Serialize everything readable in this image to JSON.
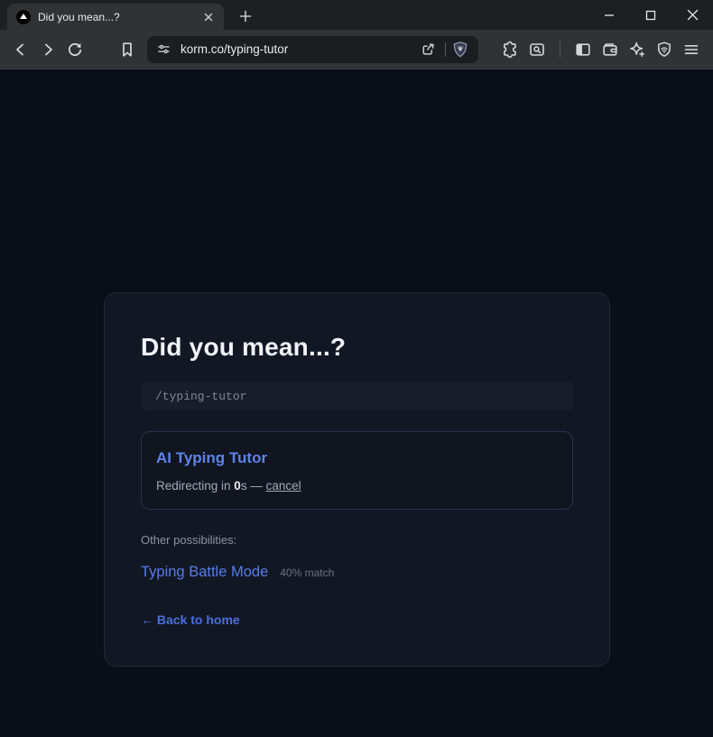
{
  "window": {
    "tab": {
      "title": "Did you mean...?"
    }
  },
  "toolbar": {
    "url": "korm.co/typing-tutor"
  },
  "page": {
    "title": "Did you mean...?",
    "path_input": "/typing-tutor",
    "suggestion": {
      "title": "AI Typing Tutor",
      "redirect_prefix": "Redirecting in ",
      "redirect_seconds": "0",
      "redirect_suffix": "s — ",
      "cancel_label": "cancel"
    },
    "other_heading": "Other possibilities:",
    "alternatives": [
      {
        "label": "Typing Battle Mode",
        "match": "40% match"
      }
    ],
    "back_link": "← Back to home"
  },
  "colors": {
    "page_bg": "#0a0e17",
    "card_bg": "#121724",
    "accent_blue": "#5d84ea",
    "link_blue": "#4a70e0",
    "toolbar_bg": "#313236",
    "tabstrip_bg": "#1e1f22"
  }
}
